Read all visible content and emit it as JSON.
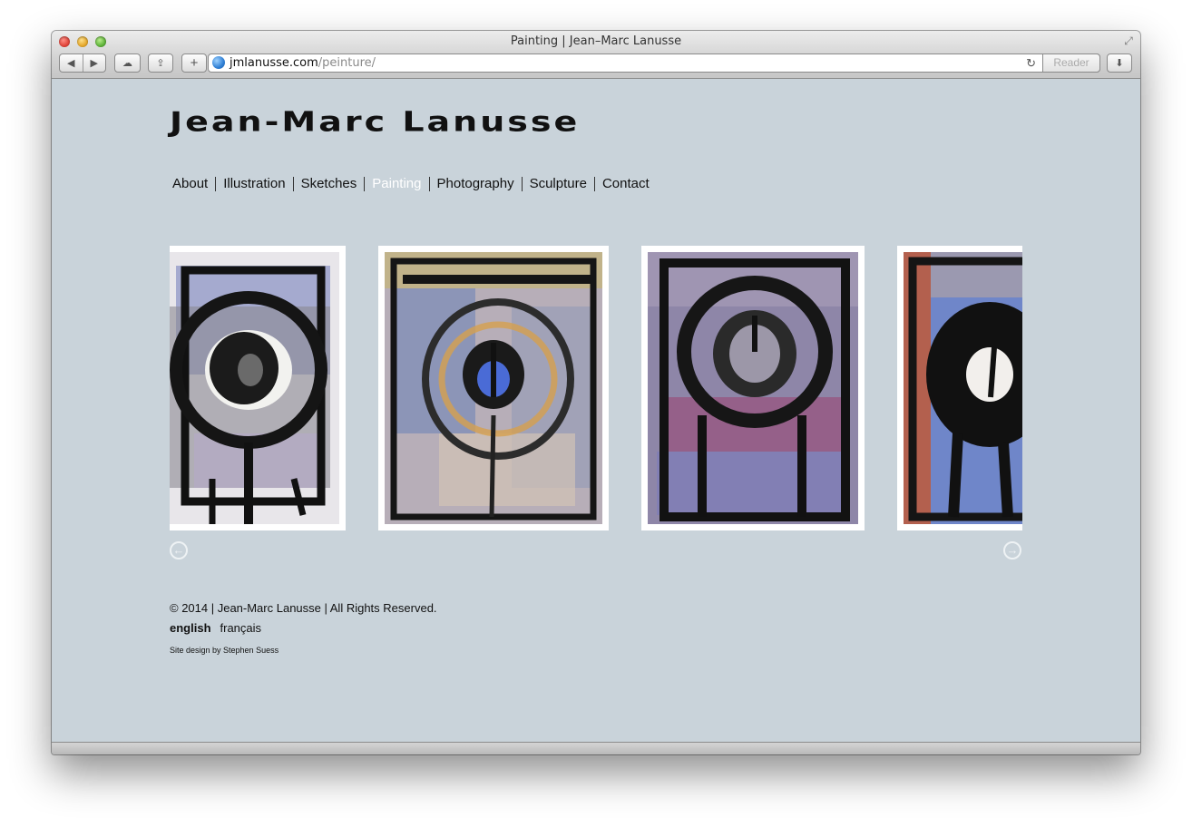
{
  "window": {
    "title": "Painting | Jean–Marc Lanusse",
    "url_domain": "jmlanusse.com",
    "url_path": "/peinture/",
    "reader_label": "Reader"
  },
  "toolbar": {
    "back_icon": "◀",
    "forward_icon": "▶",
    "cloud_icon": "☁",
    "share_icon": "⇪",
    "plus_icon": "+",
    "reload_icon": "↻",
    "download_icon": "⬇",
    "fullscreen_icon": "⤢"
  },
  "site": {
    "logo": "Jean-Marc Lanusse",
    "menu": [
      {
        "label": "About"
      },
      {
        "label": "Illustration"
      },
      {
        "label": "Sketches"
      },
      {
        "label": "Painting"
      },
      {
        "label": "Photography"
      },
      {
        "label": "Sculpture"
      },
      {
        "label": "Contact"
      }
    ],
    "active_menu": "Painting"
  },
  "gallery": {
    "prev_icon": "←",
    "next_icon": "→"
  },
  "footer": {
    "copyright": "© 2014 | Jean-Marc Lanusse | All Rights Reserved.",
    "lang_english": "english",
    "lang_french": "français",
    "credit": "Site design by Stephen Suess"
  },
  "colors": {
    "page_bg": "#c9d3da",
    "active_menu": "#ffffff"
  }
}
